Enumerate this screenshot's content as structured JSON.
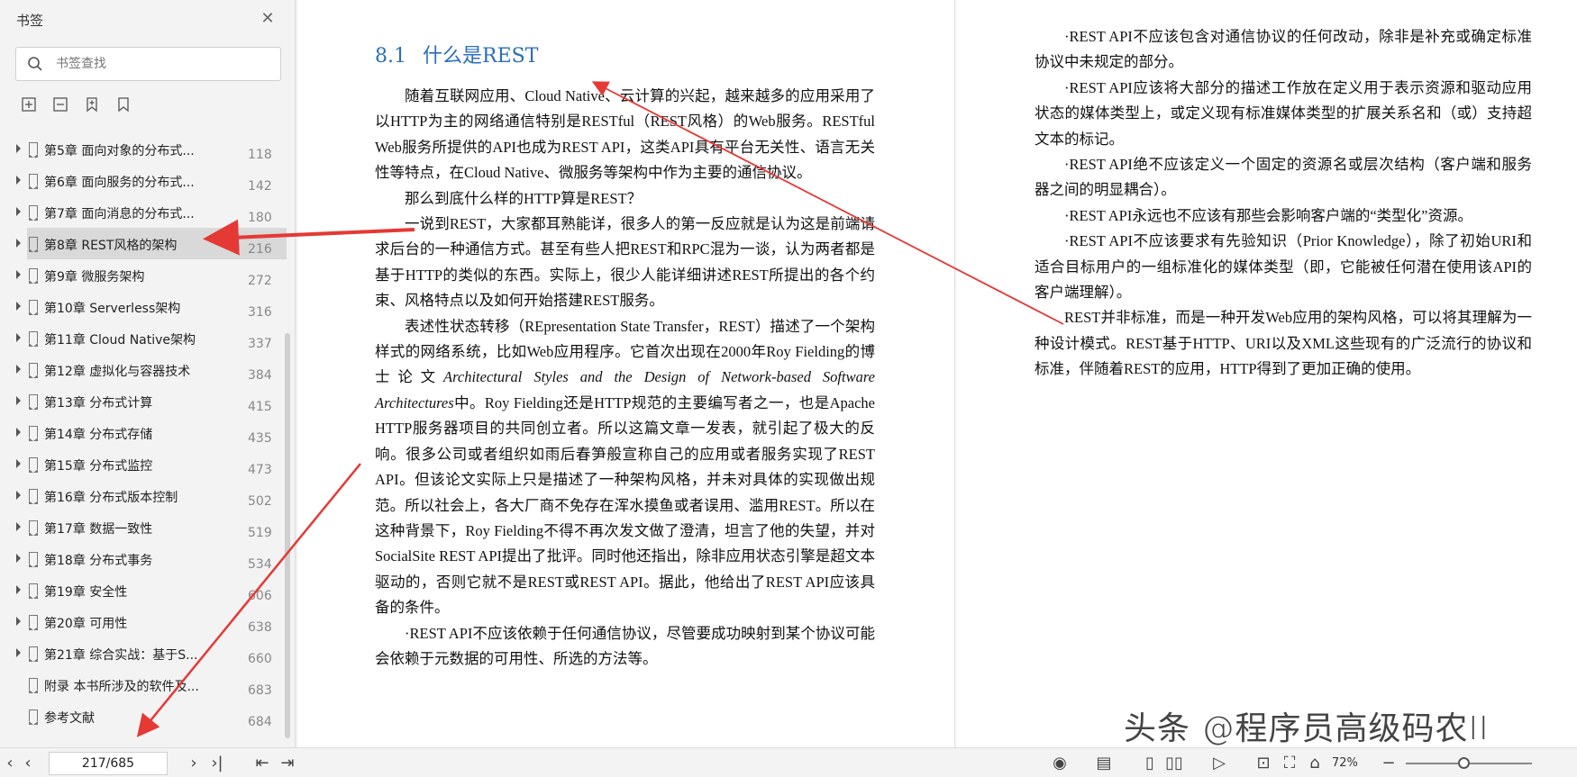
{
  "sidebar": {
    "title": "书签",
    "search_placeholder": "书签查找",
    "items": [
      {
        "label": "第5章 面向对象的分布式...",
        "page": "118",
        "has_children": true,
        "active": false
      },
      {
        "label": "第6章 面向服务的分布式...",
        "page": "142",
        "has_children": true,
        "active": false
      },
      {
        "label": "第7章 面向消息的分布式...",
        "page": "180",
        "has_children": true,
        "active": false
      },
      {
        "label": "第8章 REST风格的架构",
        "page": "216",
        "has_children": true,
        "active": true
      },
      {
        "label": "第9章 微服务架构",
        "page": "272",
        "has_children": true,
        "active": false
      },
      {
        "label": "第10章 Serverless架构",
        "page": "316",
        "has_children": true,
        "active": false
      },
      {
        "label": "第11章 Cloud Native架构",
        "page": "337",
        "has_children": true,
        "active": false
      },
      {
        "label": "第12章 虚拟化与容器技术",
        "page": "384",
        "has_children": true,
        "active": false
      },
      {
        "label": "第13章 分布式计算",
        "page": "415",
        "has_children": true,
        "active": false
      },
      {
        "label": "第14章 分布式存储",
        "page": "435",
        "has_children": true,
        "active": false
      },
      {
        "label": "第15章 分布式监控",
        "page": "473",
        "has_children": true,
        "active": false
      },
      {
        "label": "第16章 分布式版本控制",
        "page": "502",
        "has_children": true,
        "active": false
      },
      {
        "label": "第17章 数据一致性",
        "page": "519",
        "has_children": true,
        "active": false
      },
      {
        "label": "第18章 分布式事务",
        "page": "534",
        "has_children": true,
        "active": false
      },
      {
        "label": "第19章 安全性",
        "page": "606",
        "has_children": true,
        "active": false
      },
      {
        "label": "第20章 可用性",
        "page": "638",
        "has_children": true,
        "active": false
      },
      {
        "label": "第21章 综合实战：基于S...",
        "page": "660",
        "has_children": true,
        "active": false
      },
      {
        "label": "附录 本书所涉及的软件及...",
        "page": "683",
        "has_children": false,
        "active": false
      },
      {
        "label": "参考文献",
        "page": "684",
        "has_children": false,
        "active": false
      }
    ]
  },
  "document": {
    "section_number": "8.1",
    "section_title": "什么是REST",
    "left_paragraphs": [
      "随着互联网应用、Cloud Native、云计算的兴起，越来越多的应用采用了以HTTP为主的网络通信特别是RESTful（REST风格）的Web服务。RESTful Web服务所提供的API也成为REST API，这类API具有平台无关性、语言无关性等特点，在Cloud Native、微服务等架构中作为主要的通信协议。",
      "那么到底什么样的HTTP算是REST？",
      "一说到REST，大家都耳熟能详，很多人的第一反应就是认为这是前端请求后台的一种通信方式。甚至有些人把REST和RPC混为一谈，认为两者都是基于HTTP的类似的东西。实际上，很少人能详细讲述REST所提出的各个约束、风格特点以及如何开始搭建REST服务。",
      "表述性状态转移（REpresentation State Transfer，REST）描述了一个架构样式的网络系统，比如Web应用程序。它首次出现在2000年Roy Fielding的博士论文",
      "Architectural Styles and the Design of Network-based Software Architectures",
      "中。Roy Fielding还是HTTP规范的主要编写者之一，也是Apache HTTP服务器项目的共同创立者。所以这篇文章一发表，就引起了极大的反响。很多公司或者组织如雨后春笋般宣称自己的应用或者服务实现了REST API。但该论文实际上只是描述了一种架构风格，并未对具体的实现做出规范。所以社会上，各大厂商不免存在浑水摸鱼或者误用、滥用REST。所以在这种背景下，Roy Fielding不得不再次发文做了澄清，坦言了他的失望，并对SocialSite REST API提出了批评。同时他还指出，除非应用状态引擎是超文本驱动的，否则它就不是REST或REST API。据此，他给出了REST API应该具备的条件。",
      "·REST API不应该依赖于任何通信协议，尽管要成功映射到某个协议可能会依赖于元数据的可用性、所选的方法等。"
    ],
    "right_paragraphs": [
      "·REST API不应该包含对通信协议的任何改动，除非是补充或确定标准协议中未规定的部分。",
      "·REST API应该将大部分的描述工作放在定义用于表示资源和驱动应用状态的媒体类型上，或定义现有标准媒体类型的扩展关系名和（或）支持超文本的标记。",
      "·REST API绝不应该定义一个固定的资源名或层次结构（客户端和服务器之间的明显耦合）。",
      "·REST API永远也不应该有那些会影响客户端的“类型化”资源。",
      "·REST API不应该要求有先验知识（Prior Knowledge），除了初始URI和适合目标用户的一组标准化的媒体类型（即，它能被任何潜在使用该API的客户端理解）。",
      "REST并非标准，而是一种开发Web应用的架构风格，可以将其理解为一种设计模式。REST基于HTTP、URI以及XML这些现有的广泛流行的协议和标准，伴随着REST的应用，HTTP得到了更加正确的使用。"
    ]
  },
  "watermark": "头条 @程序员高级码农II",
  "statusbar": {
    "page_indicator": "217/685",
    "zoom": "72%"
  },
  "colors": {
    "title_blue": "#2a6fb8",
    "annotation_red": "#e53935"
  }
}
